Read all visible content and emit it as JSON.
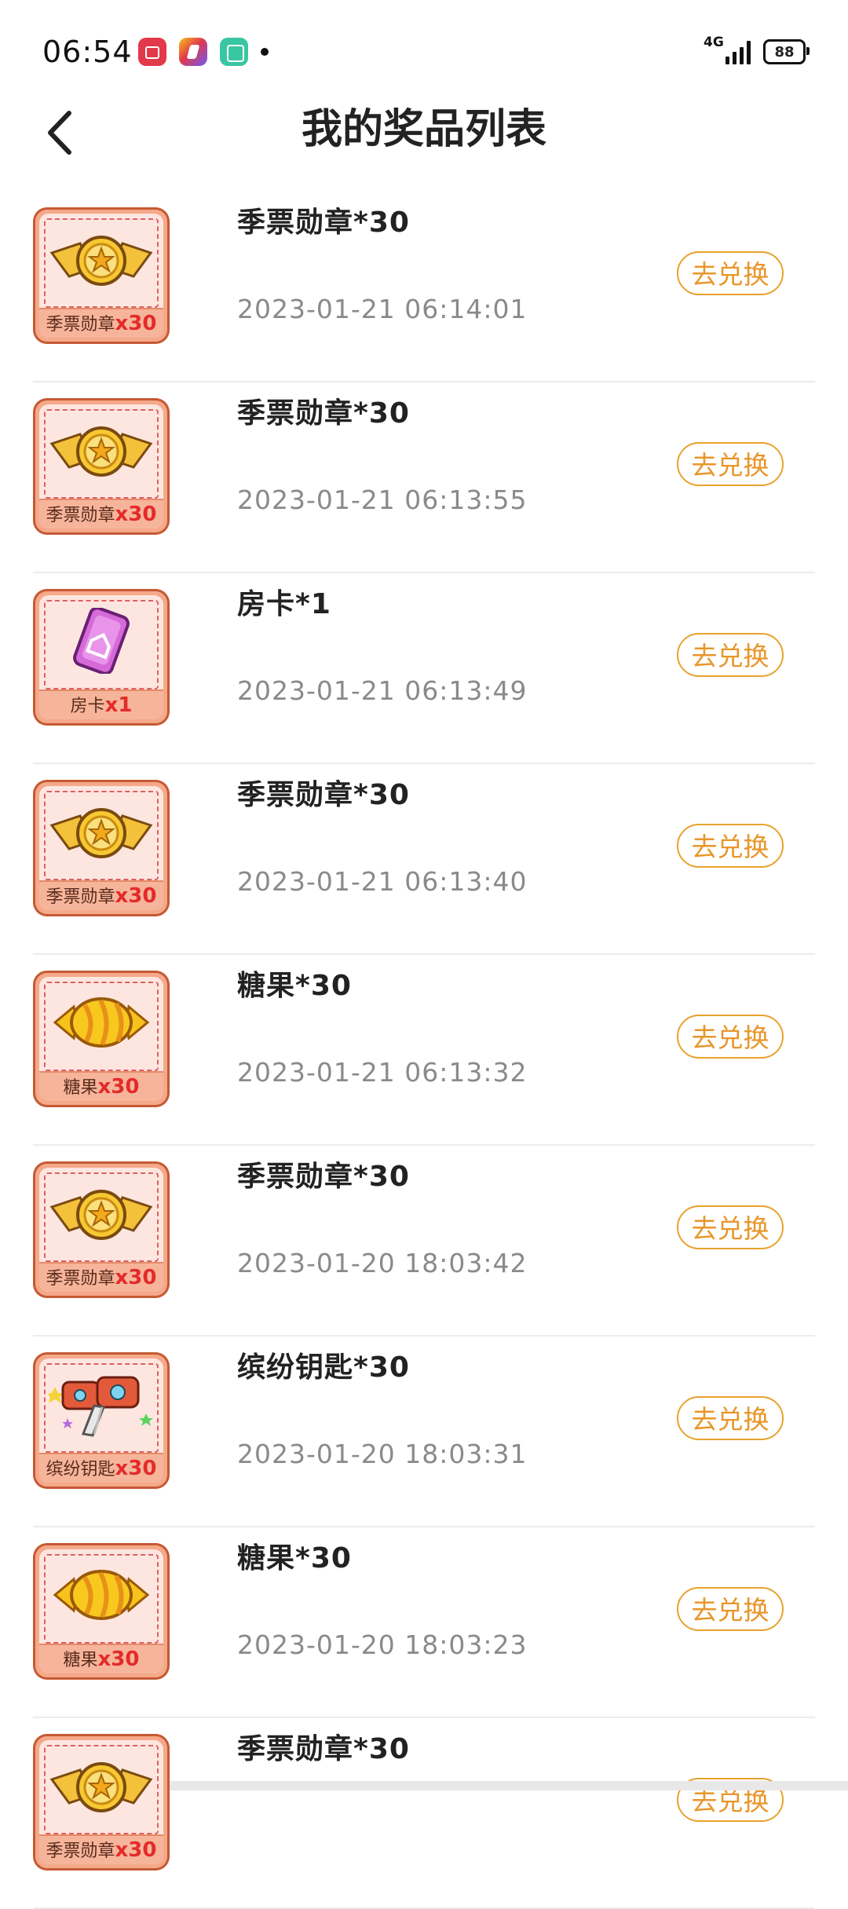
{
  "status_bar": {
    "time": "06:54",
    "notification_icons": [
      "video-app-icon",
      "shortcut-app-icon",
      "gallery-app-icon",
      "more-dot-icon"
    ],
    "network": "4G",
    "battery": "88"
  },
  "header": {
    "back_icon": "chevron-left-icon",
    "title": "我的奖品列表"
  },
  "colors": {
    "accent": "#e8962a",
    "thumb_frame": "#f5a98a",
    "thumb_bg": "#fde6e0",
    "qty_red": "#e32b2b"
  },
  "prizes": [
    {
      "name": "季票勋章*30",
      "time": "2023-01-21 06:14:01",
      "thumb_label": "季票勋章",
      "thumb_qty": "x30",
      "icon": "medal-icon",
      "action": "去兑换"
    },
    {
      "name": "季票勋章*30",
      "time": "2023-01-21 06:13:55",
      "thumb_label": "季票勋章",
      "thumb_qty": "x30",
      "icon": "medal-icon",
      "action": "去兑换"
    },
    {
      "name": "房卡*1",
      "time": "2023-01-21 06:13:49",
      "thumb_label": "房卡",
      "thumb_qty": "x1",
      "icon": "room-card-icon",
      "action": "去兑换"
    },
    {
      "name": "季票勋章*30",
      "time": "2023-01-21 06:13:40",
      "thumb_label": "季票勋章",
      "thumb_qty": "x30",
      "icon": "medal-icon",
      "action": "去兑换"
    },
    {
      "name": "糖果*30",
      "time": "2023-01-21 06:13:32",
      "thumb_label": "糖果",
      "thumb_qty": "x30",
      "icon": "candy-icon",
      "action": "去兑换"
    },
    {
      "name": "季票勋章*30",
      "time": "2023-01-20 18:03:42",
      "thumb_label": "季票勋章",
      "thumb_qty": "x30",
      "icon": "medal-icon",
      "action": "去兑换"
    },
    {
      "name": "缤纷钥匙*30",
      "time": "2023-01-20 18:03:31",
      "thumb_label": "缤纷钥匙",
      "thumb_qty": "x30",
      "icon": "key-icon",
      "action": "去兑换"
    },
    {
      "name": "糖果*30",
      "time": "2023-01-20 18:03:23",
      "thumb_label": "糖果",
      "thumb_qty": "x30",
      "icon": "candy-icon",
      "action": "去兑换"
    },
    {
      "name": "季票勋章*30",
      "time": "",
      "thumb_label": "季票勋章",
      "thumb_qty": "x30",
      "icon": "medal-icon",
      "action": "去兑换"
    }
  ]
}
